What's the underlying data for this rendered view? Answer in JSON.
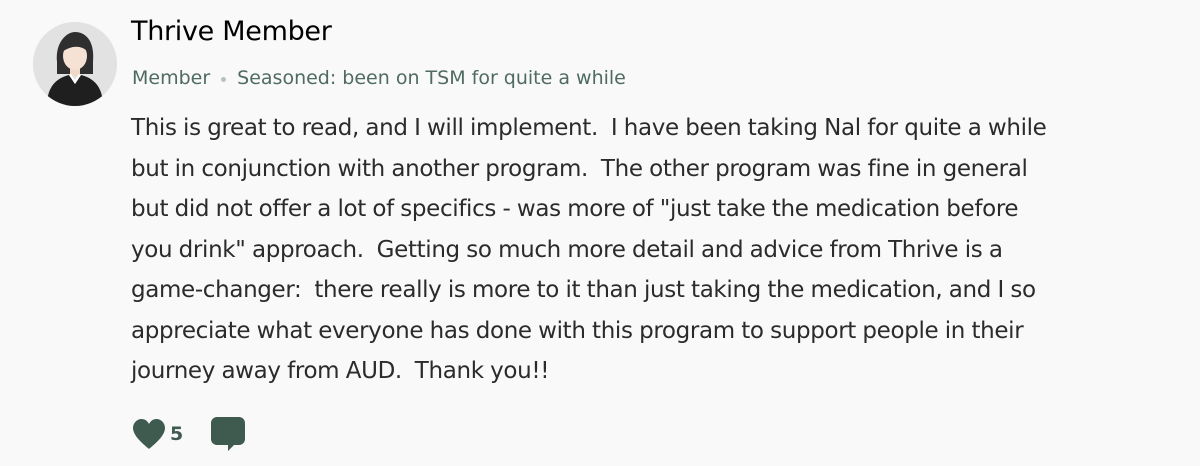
{
  "post": {
    "author": {
      "name": "Thrive Member",
      "role": "Member",
      "tenure": "Seasoned: been on TSM for quite a while",
      "avatar_icon": "female-user-avatar-icon"
    },
    "body_lines": [
      "This is great to read, and I will implement.  I have been taking Nal for quite a while",
      "but in conjunction with another program.  The other program was fine in general",
      "but did not offer a lot of specifics - was more of \"just take the medication before",
      "you drink\" approach.  Getting so much more detail and advice from Thrive is a",
      "game-changer:  there really is more to it than just taking the medication, and I so",
      "appreciate what everyone has done with this program to support people in their",
      "journey away from AUD.  Thank you!!"
    ],
    "reactions": {
      "like_icon": "heart-icon",
      "like_count": "5",
      "comment_icon": "comment-bubble-icon"
    }
  },
  "colors": {
    "background": "#f9f9f9",
    "meta_text": "#4f6b60",
    "body_text": "#2b2b2b",
    "accent_green": "#3f5a4f"
  }
}
